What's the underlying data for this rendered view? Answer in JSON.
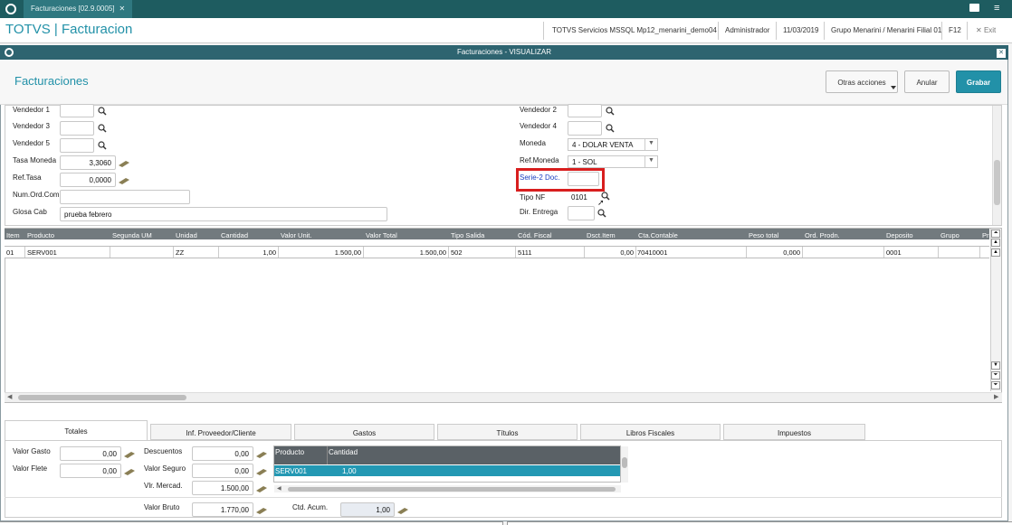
{
  "app": {
    "tab_title": "Facturaciones [02.9.0005]",
    "brand": "TOTVS | Facturacion",
    "env": "TOTVS Servicios MSSQL Mp12_menarini_demo04",
    "user": "Administrador",
    "date": "11/03/2019",
    "branch": "Grupo Menarini / Menarini Filial 01",
    "f12": "F12",
    "exit": "Exit"
  },
  "dialog": {
    "title": "Facturaciones - VISUALIZAR",
    "heading": "Facturaciones",
    "other_actions": "Otras acciones",
    "cancel": "Anular",
    "save": "Grabar"
  },
  "form": {
    "vendedor1": "Vendedor 1",
    "vendedor3": "Vendedor 3",
    "vendedor5": "Vendedor 5",
    "tasa_moneda_label": "Tasa Moneda",
    "tasa_moneda": "3,3060",
    "ref_tasa_label": "Ref.Tasa",
    "ref_tasa": "0,0000",
    "num_ord_label": "Num.Ord.Com.",
    "glosa_label": "Glosa Cab",
    "glosa": "prueba febrero",
    "vendedor2": "Vendedor 2",
    "vendedor4": "Vendedor 4",
    "moneda_label": "Moneda",
    "moneda": "4 - DOLAR VENTA",
    "ref_moneda_label": "Ref.Moneda",
    "ref_moneda": "1 - SOL",
    "serie_label": "Serie-2 Doc.",
    "tipo_nf_label": "Tipo NF",
    "tipo_nf": "0101",
    "dir_entrega_label": "Dir. Entrega"
  },
  "grid": {
    "headers": [
      "Item",
      "Producto",
      "Segunda UM",
      "Unidad",
      "Cantidad",
      "Valor Unit.",
      "Valor Total",
      "Tipo Salida",
      "Cód. Fiscal",
      "Dsct.Item",
      "Cta.Contable",
      "Peso total",
      "Ord. Prodn.",
      "Deposito",
      "Grupo",
      "Pr"
    ],
    "row": [
      "01",
      "SERV001",
      "",
      "ZZ",
      "1,00",
      "1.500,00",
      "1.500,00",
      "502",
      "5111",
      "0,00",
      "70410001",
      "0,000",
      "",
      "0001",
      "",
      ""
    ]
  },
  "bottom_tabs": [
    "Totales",
    "Inf. Proveedor/Cliente",
    "Gastos",
    "Títulos",
    "Libros Fiscales",
    "Impuestos"
  ],
  "totals": {
    "valor_gasto_label": "Valor Gasto",
    "valor_gasto": "0,00",
    "valor_flete_label": "Valor Flete",
    "valor_flete": "0,00",
    "descuentos_label": "Descuentos",
    "descuentos": "0,00",
    "valor_seguro_label": "Valor Seguro",
    "valor_seguro": "0,00",
    "vlr_mercad_label": "Vlr. Mercad.",
    "vlr_mercad": "1.500,00",
    "valor_bruto_label": "Valor Bruto",
    "valor_bruto": "1.770,00",
    "ctd_acum_label": "Ctd. Acum.",
    "ctd_acum": "1,00",
    "sub_headers": [
      "Producto",
      "Cantidad"
    ],
    "sub_row": [
      "SERV001",
      "1,00"
    ]
  },
  "colors": {
    "accent": "#2291a8",
    "topbar": "#1e5c60",
    "title_bar": "#2e6470",
    "selected_row": "#2398b3",
    "highlight": "#d81e1e"
  }
}
